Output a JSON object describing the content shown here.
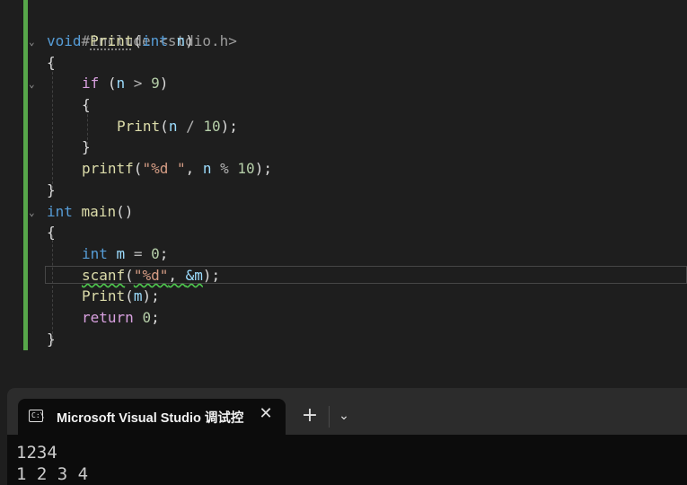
{
  "editor": {
    "lines": [
      {
        "t1": "#include <stdio.h>"
      },
      {
        "kw": "void",
        "fn": "Print",
        "p1": "(",
        "kw2": "int",
        "par": "n",
        "p2": ")"
      },
      {
        "t": "{"
      },
      {
        "kw": "if",
        "p1": " (",
        "par": "n",
        "op": " > ",
        "num": "9",
        "p2": ")"
      },
      {
        "t": "{"
      },
      {
        "fn": "Print",
        "p1": "(",
        "par": "n",
        "op": " / ",
        "num": "10",
        "p2": ");"
      },
      {
        "t": "}"
      },
      {
        "fn": "printf",
        "p1": "(",
        "str": "\"%d \"",
        "p2": ", ",
        "par": "n",
        "op": " % ",
        "num": "10",
        "p3": ");"
      },
      {
        "t": "}"
      },
      {
        "kw": "int",
        "fn": "main",
        "p1": "()"
      },
      {
        "t": "{"
      },
      {
        "kw": "int",
        "par": "m",
        "op": " = ",
        "num": "0",
        "p2": ";"
      },
      {
        "fn": "scanf",
        "p1": "(",
        "str": "\"%d\"",
        "p2": ", ",
        "amp": "&m",
        "p3": ");"
      },
      {
        "fn": "Print",
        "p1": "(",
        "par": "m",
        "p2": ");"
      },
      {
        "kw": "return",
        "num": "0",
        "p2": ";"
      },
      {
        "t": "}"
      }
    ],
    "colors": {
      "background": "#1e1e1e",
      "keyword": "#569cd6",
      "control": "#d8a0df",
      "function": "#dcdcaa",
      "number": "#b5cea8",
      "string": "#d69d85",
      "parameter": "#9cdcfe",
      "change_bar": "#57a64a"
    }
  },
  "terminal": {
    "tab_icon": "console-icon",
    "tab_icon_text": "C:\\",
    "tab_title": "Microsoft Visual Studio 调试控",
    "close_glyph": "✕",
    "new_tab_glyph": "+",
    "dropdown_glyph": "⌄",
    "output": [
      "1234",
      "1 2 3 4"
    ]
  }
}
